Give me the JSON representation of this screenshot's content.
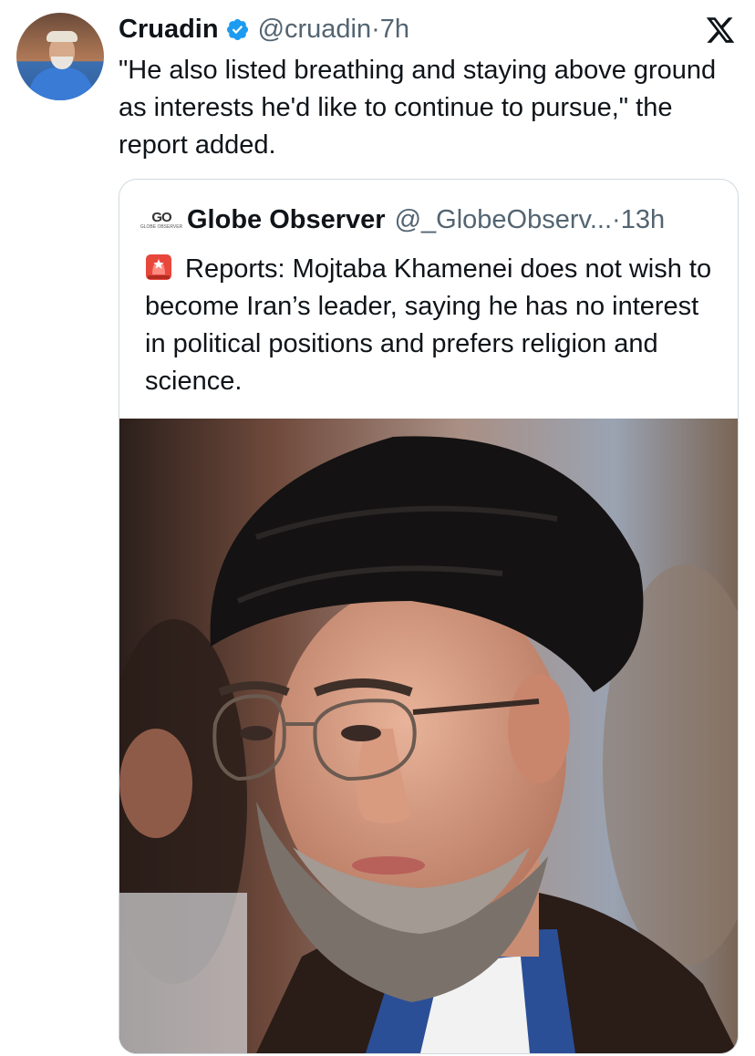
{
  "post": {
    "author_name": "Cruadin",
    "author_handle": "@cruadin",
    "separator": "·",
    "time": "7h",
    "text": "\"He also listed breathing and staying above ground as interests he'd like to continue to pursue,\" the report added.",
    "verified": true,
    "avatar_icon": "user-avatar-photo"
  },
  "quoted": {
    "logo_text": "GO",
    "logo_subtext": "GLOBE OBSERVER",
    "author_name": "Globe Observer",
    "author_handle": "@_GlobeObserv...",
    "separator": "·",
    "time": "13h",
    "emoji_icon": "rotating-light-icon",
    "text": "Reports: Mojtaba Khamenei does not wish to become Iran’s leader, saying he has no interest in political positions and prefers religion and science.",
    "image_icon": "portrait-photo"
  },
  "platform_icon": "x-logo-icon",
  "colors": {
    "text_primary": "#0f1419",
    "text_secondary": "#536471",
    "verified_blue": "#1d9bf0",
    "border": "#cfd9de"
  }
}
